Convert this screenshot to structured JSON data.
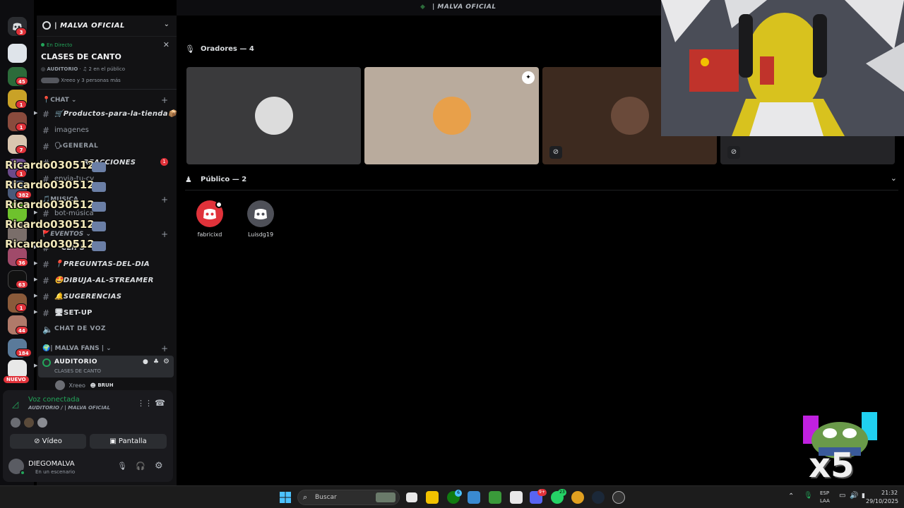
{
  "window": {
    "title": "| MALVA OFICIAL"
  },
  "rail": {
    "badges": [
      "3",
      "45",
      "1",
      "1",
      "7",
      "1",
      "382",
      "36",
      "63",
      "1",
      "44",
      "184"
    ],
    "new_label": "NUEVO"
  },
  "server": {
    "name": "| MALVA OFICIAL",
    "live": {
      "status": "En Directo",
      "title": "CLASES DE CANTO",
      "channel": "AUDITORIO",
      "audience": "2 en el público",
      "participants": "Xreeo y 3 personas más"
    }
  },
  "categories": {
    "chat": "CHAT",
    "musica": "MUSICA",
    "eventos": "EVENTOS",
    "fans": "| MALVA FANS |"
  },
  "channels": [
    {
      "name": "🛒Productos-para-la-tienda📦"
    },
    {
      "name": "imagenes"
    },
    {
      "name": "🗣GENERAL"
    },
    {
      "name": "REACCIONES",
      "badge": "1"
    },
    {
      "name": "envia-tu-cv"
    },
    {
      "name": "bot-música"
    },
    {
      "name": "CLIPS"
    },
    {
      "name": "📍PREGUNTAS-DEL-DIA"
    },
    {
      "name": "🤩DIBUJA-AL-STREAMER"
    },
    {
      "name": "🔔SUGERENCIAS"
    },
    {
      "name": "🖥SET-UP"
    },
    {
      "name": "CHAT DE VOZ"
    }
  ],
  "overlay_chat": [
    "Ricardo030512 :",
    "Ricardo030512 :",
    "Ricardo030512 :",
    "Ricardo030512 :",
    "Ricardo030512 :"
  ],
  "stage_channel": {
    "name": "AUDITORIO",
    "topic": "CLASES DE CANTO",
    "member": "Xreeo",
    "member_tag": "BRUH"
  },
  "voice": {
    "status": "Voz conectada",
    "location": "AUDITORIO / | MALVA OFICIAL",
    "video_label": "Vídeo",
    "screen_label": "Pantalla"
  },
  "user": {
    "name": "DIEGOMALVA",
    "status": "En un escenario"
  },
  "stage": {
    "speakers_label": "Oradores — 4",
    "audience_label": "Público — 2",
    "speaker_colors": [
      "#3a3a3c",
      "#b9ab9d",
      "#3d2a1f",
      "#242427"
    ],
    "audience": [
      {
        "name": "fabricixd",
        "color": "#e0323a"
      },
      {
        "name": "Luisdg19",
        "color": "#4e5058"
      }
    ]
  },
  "stream_overlay": {
    "multiplier": "x5"
  },
  "taskbar": {
    "search_placeholder": "Buscar",
    "lang": "ESP",
    "layout": "LAA",
    "time": "21:32",
    "date": "29/10/2025",
    "badges": {
      "xbox": "6",
      "discord": "9+",
      "whatsapp": "23"
    }
  },
  "colors": {
    "accent": "#5865f2",
    "online": "#23a55a",
    "danger": "#e0323a"
  }
}
